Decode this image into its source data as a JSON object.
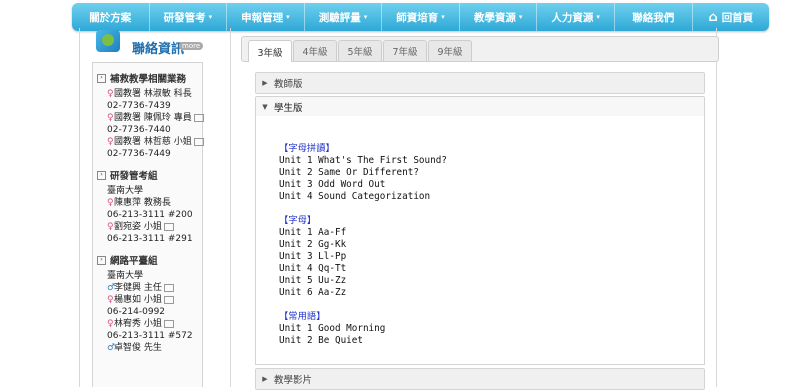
{
  "nav": {
    "items": [
      "關於方案",
      "研發管考",
      "申報管理",
      "測驗評量",
      "師資培育",
      "教學資源",
      "人力資源",
      "聯絡我們",
      "回首頁"
    ],
    "dropdown_flags": [
      false,
      true,
      true,
      true,
      true,
      true,
      true,
      false,
      false
    ]
  },
  "sidebar": {
    "title": "聯絡資訊",
    "badge": "more",
    "groups": [
      {
        "title": "補救教學相關業務",
        "lines": [
          {
            "text": "國教署 林淑敏 科長",
            "icon": "pink"
          },
          {
            "text": "02-7736-7439"
          },
          {
            "text": "國教署 陳佩玲 專員",
            "icon": "pink",
            "mail": true
          },
          {
            "text": "02-7736-7440"
          },
          {
            "text": "國教署 林哲慈 小姐",
            "icon": "pink",
            "mail": true
          },
          {
            "text": "02-7736-7449"
          }
        ]
      },
      {
        "title": "研發管考組",
        "lines": [
          {
            "text": "臺南大學"
          },
          {
            "text": "陳惠萍 教務長",
            "icon": "pink"
          },
          {
            "text": "06-213-3111 #200"
          },
          {
            "text": "劉宛姿 小姐",
            "icon": "pink",
            "mail": true
          },
          {
            "text": "06-213-3111 #291"
          }
        ]
      },
      {
        "title": "網路平臺組",
        "lines": [
          {
            "text": "臺南大學"
          },
          {
            "text": "李健興 主任",
            "icon": "blue",
            "mail": true
          },
          {
            "text": "楊惠如 小姐",
            "icon": "pink",
            "mail": true
          },
          {
            "text": "06-214-0992"
          },
          {
            "text": "林宥秀 小姐",
            "icon": "pink",
            "mail": true
          },
          {
            "text": "06-213-3111 #572"
          },
          {
            "text": "卓智俊 先生",
            "icon": "blue"
          }
        ]
      }
    ]
  },
  "tabs": [
    "3年級",
    "4年級",
    "5年級",
    "7年級",
    "9年級"
  ],
  "active_tab": 0,
  "accordion": {
    "teacher": "教師版",
    "student": "學生版",
    "video": "教學影片"
  },
  "sections": [
    {
      "title": "【字母拼讀】",
      "items": [
        "Unit 1 What's The First Sound?",
        "Unit 2 Same Or Different?",
        "Unit 3 Odd Word Out",
        "Unit 4 Sound Categorization"
      ]
    },
    {
      "title": "【字母】",
      "items": [
        "Unit 1 Aa-Ff",
        "Unit 2 Gg-Kk",
        "Unit 3 Ll-Pp",
        "Unit 4 Qq-Tt",
        "Unit 5 Uu-Zz",
        "Unit 6 Aa-Zz"
      ]
    },
    {
      "title": "【常用語】",
      "items": [
        "Unit 1 Good Morning",
        "Unit 2 Be Quiet"
      ]
    }
  ],
  "colors": {
    "nav_top": "#6fd0ee",
    "nav_bottom": "#2ea8d6",
    "section_title": "#2233cc"
  }
}
